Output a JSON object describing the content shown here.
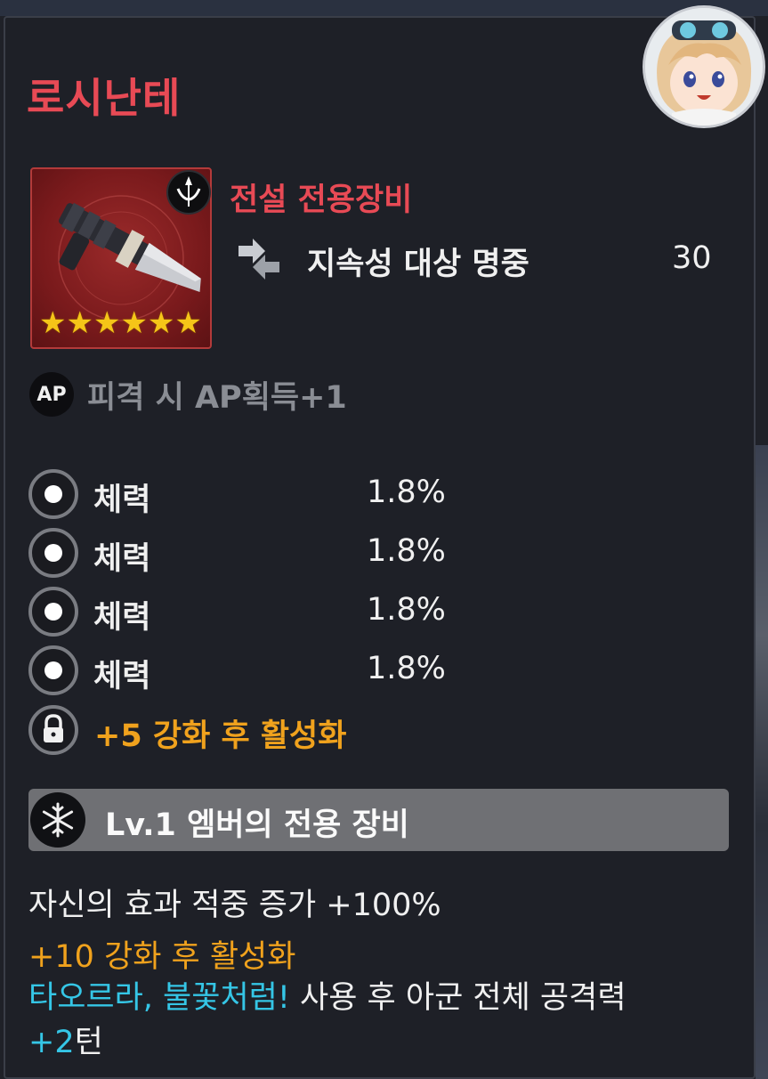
{
  "item": {
    "name": "로시난테",
    "rarity_label": "전설 전용장비",
    "stars": "★★★★★★",
    "main_stat": {
      "name": "지속성 대상 명중",
      "value": "30"
    },
    "ap_icon_text": "AP",
    "ap_effect": "피격 시 AP획득+1"
  },
  "substats": [
    {
      "name": "체력",
      "value": "1.8%"
    },
    {
      "name": "체력",
      "value": "1.8%"
    },
    {
      "name": "체력",
      "value": "1.8%"
    },
    {
      "name": "체력",
      "value": "1.8%"
    }
  ],
  "locked_substat": "+5 강화 후 활성화",
  "set_effect": {
    "title": "Lv.1 엠버의 전용 장비",
    "line1": "자신의 효과 적중 증가 +100%",
    "line2": "+10 강화 후 활성화",
    "line3_skill": "타오르라, 불꽃처럼!",
    "line3_rest": " 사용 후 아군 전체 공격력",
    "line4_value": "+2",
    "line4_rest": "턴"
  },
  "colors": {
    "title_red": "#e84a55",
    "orange": "#f0a21d",
    "cyan": "#35c6e6",
    "gray_text": "#8a8d94"
  },
  "icons": [
    "character-portrait-icon",
    "weapon-icon",
    "exclusive-badge-icon",
    "star-icon",
    "accuracy-icon",
    "ap-icon",
    "substat-ring-icon",
    "lock-icon",
    "snowflake-icon"
  ]
}
